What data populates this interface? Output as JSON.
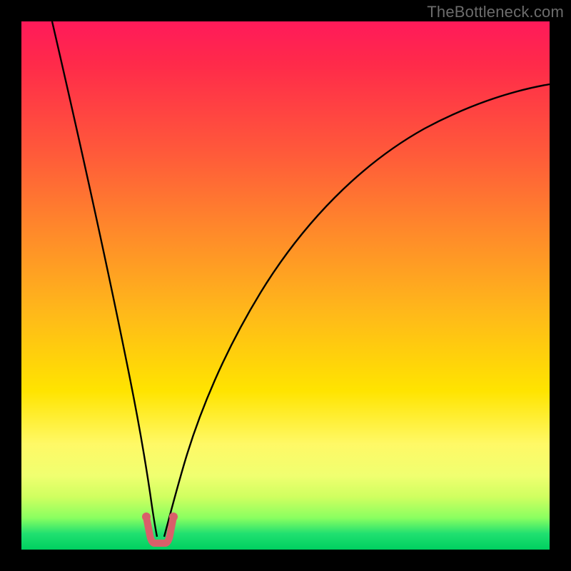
{
  "watermark": "TheBottleneck.com",
  "chart_data": {
    "type": "line",
    "title": "",
    "xlabel": "",
    "ylabel": "",
    "xlim": [
      0,
      100
    ],
    "ylim": [
      0,
      100
    ],
    "grid": false,
    "legend": false,
    "series": [
      {
        "name": "left-branch",
        "x": [
          5,
          8,
          11,
          14,
          17,
          20,
          22,
          23.5,
          24.5,
          25
        ],
        "values": [
          100,
          86,
          72,
          58,
          44,
          30,
          18,
          10,
          5,
          2
        ]
      },
      {
        "name": "right-branch",
        "x": [
          26,
          27,
          28.5,
          31,
          35,
          40,
          46,
          54,
          63,
          73,
          84,
          96,
          100
        ],
        "values": [
          2,
          5,
          10,
          20,
          33,
          45,
          55,
          64,
          71,
          77,
          82,
          85,
          86
        ]
      },
      {
        "name": "bottom-marker",
        "x": [
          23,
          24,
          25,
          26,
          27,
          28
        ],
        "values": [
          5,
          2,
          1,
          1,
          2,
          5
        ]
      }
    ],
    "gradient_stops": [
      {
        "pct": 0,
        "color": "#ff1a5a"
      },
      {
        "pct": 25,
        "color": "#ff5a3a"
      },
      {
        "pct": 55,
        "color": "#ffb81a"
      },
      {
        "pct": 80,
        "color": "#fff966"
      },
      {
        "pct": 94,
        "color": "#8aff60"
      },
      {
        "pct": 100,
        "color": "#00d060"
      }
    ]
  }
}
